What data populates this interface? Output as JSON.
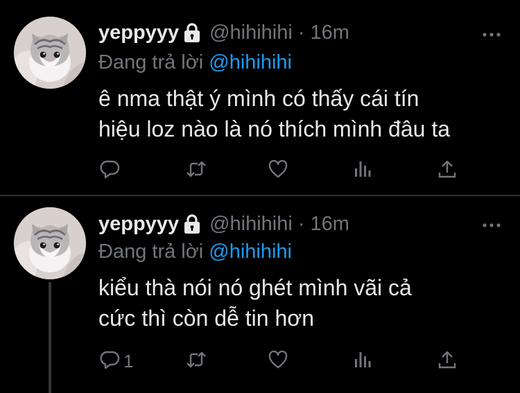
{
  "tweets": [
    {
      "display_name": "yeppyyy",
      "handle": "@hihihihi",
      "separator": "·",
      "time": "16m",
      "reply_prefix": "Đang trả lời",
      "reply_handle": "@hihihihi",
      "text_line1": "ê nma thật ý mình có thấy cái tín",
      "text_line2": "hiệu loz nào là nó thích mình đâu ta",
      "reply_count": ""
    },
    {
      "display_name": "yeppyyy",
      "handle": "@hihihihi",
      "separator": "·",
      "time": "16m",
      "reply_prefix": "Đang trả lời",
      "reply_handle": "@hihihihi",
      "text_line1": "kiểu thà nói nó ghét mình vãi cả",
      "text_line2": "cức thì còn dễ tin hơn",
      "reply_count": "1"
    }
  ],
  "colors": {
    "background": "#000000",
    "text": "#e7e9ea",
    "muted": "#71767b",
    "link": "#1d9bf0",
    "divider": "#2f3336"
  },
  "icons": [
    "lock-icon",
    "more-icon",
    "reply-icon",
    "retweet-icon",
    "like-icon",
    "views-icon",
    "share-icon"
  ]
}
